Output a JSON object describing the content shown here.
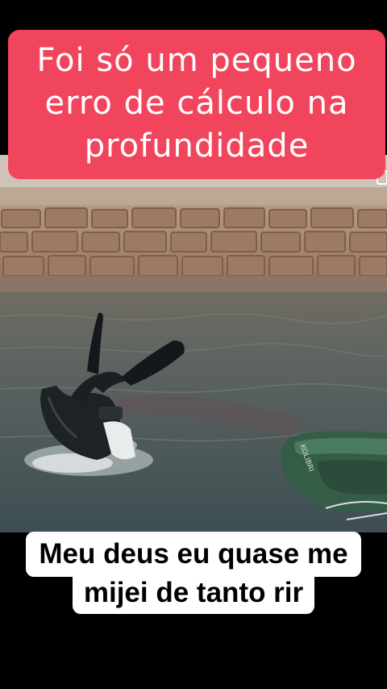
{
  "caption_top": {
    "lines": [
      "Foi só um pequeno",
      "erro de cálculo na",
      "profundidade"
    ],
    "background": "#f1455d",
    "text_color": "#ffffff"
  },
  "caption_bottom": {
    "lines": [
      "Meu deus eu quase me",
      "mijei de tanto rir"
    ],
    "background": "#ffffff",
    "text_color": "#000000"
  },
  "scene": {
    "elements": [
      "stone-wall",
      "water",
      "diver-in-wetsuit",
      "swim-fins",
      "inflatable-boat"
    ],
    "boat_color": "#3f6b52",
    "water_color": "#4f5b5a",
    "wall_color": "#a57c62"
  }
}
